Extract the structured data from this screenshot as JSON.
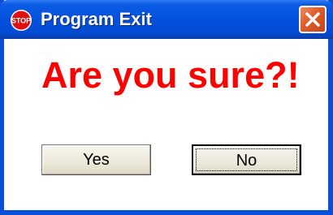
{
  "window": {
    "title": "Program Exit",
    "icon": "stop-sign-icon",
    "icon_text": "STOP",
    "close_icon": "close-icon"
  },
  "dialog": {
    "message": "Are you sure?!",
    "message_color": "#ff0000"
  },
  "buttons": {
    "yes_label": "Yes",
    "no_label": "No",
    "focused": "No"
  },
  "colors": {
    "titlebar": "#0451dd",
    "close_button": "#e05a2a",
    "frame_border": "#0a4fd8"
  }
}
